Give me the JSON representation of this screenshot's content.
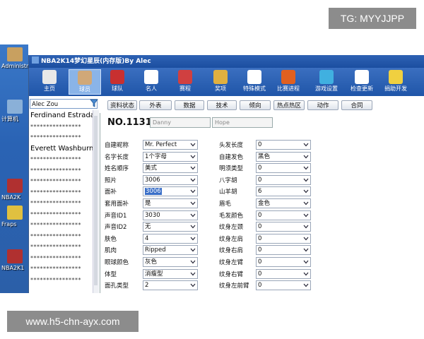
{
  "watermarks": {
    "top_right": "TG: MYYJJPP",
    "bottom_left": "www.h5-chn-ayx.com"
  },
  "desktop_icons": [
    {
      "label": "Administr",
      "color": "#c8a060"
    },
    {
      "label": "计算机",
      "color": "#8ab0d8"
    },
    {
      "label": "NBA2K",
      "color": "#b03030"
    },
    {
      "label": "Fraps",
      "color": "#e0c040"
    },
    {
      "label": "NBA2K1",
      "color": "#b03030"
    }
  ],
  "app": {
    "title": "NBA2K14梦幻星辰(内存版)By Alec",
    "toolbar": [
      {
        "label": "主页",
        "icon": "home-icon",
        "color": "#e8e8e8"
      },
      {
        "label": "球员",
        "icon": "player-icon",
        "color": "#d0a878",
        "active": true
      },
      {
        "label": "球队",
        "icon": "team-icon",
        "color": "#c83030"
      },
      {
        "label": "名人",
        "icon": "alec-signature-icon",
        "color": "#ffffff"
      },
      {
        "label": "赛程",
        "icon": "calendar-icon",
        "color": "#d04040"
      },
      {
        "label": "奖项",
        "icon": "trophy-icon",
        "color": "#e0b040"
      },
      {
        "label": "特殊模式",
        "icon": "special-mode-icon",
        "color": "#ffffff"
      },
      {
        "label": "比赛进程",
        "icon": "gatorade-icon",
        "color": "#e06020"
      },
      {
        "label": "游戏设置",
        "icon": "gear-icon",
        "color": "#40b0e0"
      },
      {
        "label": "检查更新",
        "icon": "download-icon",
        "color": "#ffffff"
      },
      {
        "label": "捐助开发",
        "icon": "dollar-icon",
        "color": "#f0d040"
      }
    ],
    "search_value": "Alec Zou",
    "players": [
      {
        "text": "Ferdinand Estrada",
        "kind": "name"
      },
      {
        "text": "****************",
        "kind": "stars"
      },
      {
        "text": "****************",
        "kind": "stars"
      },
      {
        "text": "Everett Washburn",
        "kind": "name"
      },
      {
        "text": "****************",
        "kind": "stars"
      },
      {
        "text": "****************",
        "kind": "stars"
      },
      {
        "text": "****************",
        "kind": "stars"
      },
      {
        "text": "****************",
        "kind": "stars"
      },
      {
        "text": "****************",
        "kind": "stars"
      },
      {
        "text": "****************",
        "kind": "stars"
      },
      {
        "text": "****************",
        "kind": "stars"
      },
      {
        "text": "****************",
        "kind": "stars"
      },
      {
        "text": "****************",
        "kind": "stars"
      },
      {
        "text": "****************",
        "kind": "stars"
      },
      {
        "text": "****************",
        "kind": "stars"
      },
      {
        "text": "****************",
        "kind": "stars"
      }
    ],
    "tabs": [
      "资料状态",
      "外表",
      "数据",
      "技术",
      "倾向",
      "热点热区",
      "动作",
      "合同"
    ],
    "player_number": "NO.1131",
    "first_name": "Danny",
    "last_name": "Hope",
    "left_fields": [
      {
        "label": "自建昵称",
        "value": "Mr. Perfect"
      },
      {
        "label": "名字长度",
        "value": "1个字母"
      },
      {
        "label": "姓名顺序",
        "value": "美式"
      },
      {
        "label": "照片",
        "value": "3006"
      },
      {
        "label": "面补",
        "value": "3006",
        "highlighted": true
      },
      {
        "label": "套用面补",
        "value": "是"
      },
      {
        "label": "声音ID1",
        "value": "3030"
      },
      {
        "label": "声音ID2",
        "value": "无"
      },
      {
        "label": "肤色",
        "value": "4"
      },
      {
        "label": "肌肉",
        "value": "Ripped"
      },
      {
        "label": "眼球颜色",
        "value": "灰色"
      },
      {
        "label": "体型",
        "value": "消瘦型"
      },
      {
        "label": "面孔类型",
        "value": "2"
      }
    ],
    "right_fields": [
      {
        "label": "头发长度",
        "value": "0"
      },
      {
        "label": "自建发色",
        "value": "黑色"
      },
      {
        "label": "明须类型",
        "value": "0"
      },
      {
        "label": "八字胡",
        "value": "0"
      },
      {
        "label": "山羊胡",
        "value": "6"
      },
      {
        "label": "眉毛",
        "value": "金色"
      },
      {
        "label": "毛发颜色",
        "value": "0"
      },
      {
        "label": "纹身左颈",
        "value": "0"
      },
      {
        "label": "纹身左肩",
        "value": "0"
      },
      {
        "label": "纹身右肩",
        "value": "0"
      },
      {
        "label": "纹身左臂",
        "value": "0"
      },
      {
        "label": "纹身右臂",
        "value": "0"
      },
      {
        "label": "纹身左前臂",
        "value": "0"
      }
    ]
  }
}
